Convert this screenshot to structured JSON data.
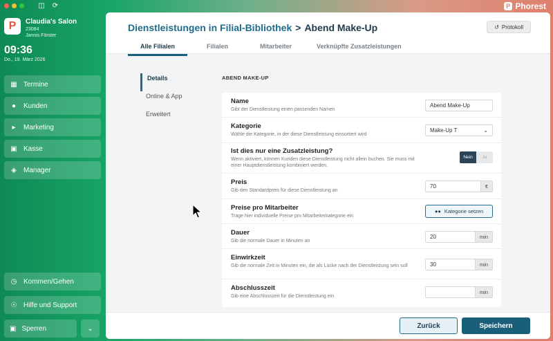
{
  "brand": {
    "name": "Phorest"
  },
  "salon": {
    "logo": "P",
    "name": "Claudia's Salon",
    "id": "23084",
    "user": "Jannis Förster"
  },
  "clock": {
    "time": "09:36",
    "date": "Do., 19. März 2026"
  },
  "nav": [
    {
      "label": "Termine",
      "icon": "calendar-icon"
    },
    {
      "label": "Kunden",
      "icon": "person-icon"
    },
    {
      "label": "Marketing",
      "icon": "megaphone-icon"
    },
    {
      "label": "Kasse",
      "icon": "cart-icon"
    },
    {
      "label": "Manager",
      "icon": "layers-icon"
    }
  ],
  "bottom_nav": [
    {
      "label": "Kommen/Gehen",
      "icon": "clock-icon"
    },
    {
      "label": "Hilfe und Support",
      "icon": "globe-icon"
    }
  ],
  "lock": {
    "label": "Sperren"
  },
  "header": {
    "crumb_parent": "Dienstleistungen in Filial-Bibliothek",
    "separator": ">",
    "crumb_current": "Abend Make-Up",
    "protokoll": "Protokoll",
    "tabs": [
      "Alle Filialen",
      "Filialen",
      "Mitarbeiter",
      "Verknüpfte Zusatzleistungen"
    ]
  },
  "subnav": [
    "Details",
    "Online & App",
    "Erweitert"
  ],
  "section_title": "ABEND MAKE-UP",
  "form": {
    "name": {
      "title": "Name",
      "desc": "Gibt der Dienstleistung einen passenden Namen",
      "value": "Abend Make-Up"
    },
    "kategorie": {
      "title": "Kategorie",
      "desc": "Wähle die Kategorie, in der diese Dienstleistung einsortiert wird",
      "value": "Make-Up T"
    },
    "zusatz": {
      "title": "Ist dies nur eine Zusatzleistung?",
      "desc": "Wenn aktiviert, können Kunden diese Dienstleistung nicht allein buchen. Sie muss mit einer Hauptdienstleistung kombiniert werden.",
      "no": "Nein",
      "yes": "Ja"
    },
    "preis": {
      "title": "Preis",
      "desc": "Gib den Standardpreis für diese Dienstleistung an",
      "value": "70",
      "unit": "€"
    },
    "preise_mitarbeiter": {
      "title": "Preise pro Mitarbeiter",
      "desc": "Trage hier individuelle Preise pro Mitarbeiterkategorie ein",
      "button": "Kategorie setzen"
    },
    "dauer": {
      "title": "Dauer",
      "desc": "Gib die normale Dauer in Minuten an",
      "value": "20",
      "unit": "min"
    },
    "einwirkzeit": {
      "title": "Einwirkzeit",
      "desc": "Gib die normale Zeit in Minuten ein, die als Lücke nach der Dienstleistung sein soll",
      "value": "30",
      "unit": "min"
    },
    "abschlusszeit": {
      "title": "Abschlusszeit",
      "desc": "Gib eine Abschlusszeit für die Dienstleistung ein",
      "value": "",
      "unit": "min"
    }
  },
  "footer": {
    "back": "Zurück",
    "save": "Speichern"
  }
}
